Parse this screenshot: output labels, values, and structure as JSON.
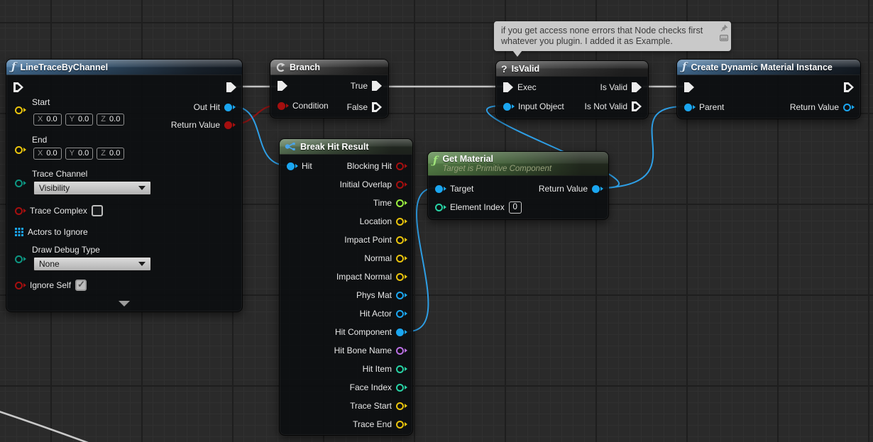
{
  "tooltip": {
    "line1": "if you get access none errors that Node checks first",
    "line2": "whatever you plugin. I added it as Example."
  },
  "colors": {
    "exec_pin": "#ececec",
    "object_pin": "#1ba6f0",
    "bool_pin": "#a50f0f",
    "vector_pin": "#eac40c",
    "float_pin": "#9bef3f",
    "int_pin": "#28d3a5",
    "enum_pin": "#0d9682",
    "name_pin": "#bb70e4",
    "exec_wire": "#c4c4c4",
    "object_wire": "#2e9fe6",
    "bool_wire": "#8c1313"
  },
  "line_trace": {
    "icon": "ƒ",
    "title": "LineTraceByChannel",
    "start": "Start",
    "end": "End",
    "out_hit": "Out Hit",
    "return_value": "Return Value",
    "trace_channel": "Trace Channel",
    "trace_channel_value": "Visibility",
    "trace_complex": "Trace Complex",
    "actors_to_ignore": "Actors to Ignore",
    "draw_debug_type": "Draw Debug Type",
    "draw_debug_value": "None",
    "ignore_self": "Ignore Self",
    "vec": {
      "x": "X",
      "y": "Y",
      "z": "Z",
      "val": "0.0"
    }
  },
  "branch": {
    "title": "Branch",
    "condition": "Condition",
    "true_label": "True",
    "false_label": "False"
  },
  "break_hit": {
    "title": "Break Hit Result",
    "hit": "Hit",
    "outputs": [
      "Blocking Hit",
      "Initial Overlap",
      "Time",
      "Location",
      "Impact Point",
      "Normal",
      "Impact Normal",
      "Phys Mat",
      "Hit Actor",
      "Hit Component",
      "Hit Bone Name",
      "Hit Item",
      "Face Index",
      "Trace Start",
      "Trace End"
    ]
  },
  "get_material": {
    "icon": "ƒ",
    "title": "Get Material",
    "subtitle": "Target is Primitive Component",
    "target": "Target",
    "element_index": "Element Index",
    "element_index_value": "0",
    "return_value": "Return Value"
  },
  "is_valid": {
    "icon": "?",
    "title": "IsValid",
    "exec": "Exec",
    "input_object": "Input Object",
    "is_valid": "Is Valid",
    "is_not_valid": "Is Not Valid"
  },
  "create_dmi": {
    "icon": "ƒ",
    "title": "Create Dynamic Material Instance",
    "parent": "Parent",
    "return_value": "Return Value"
  }
}
